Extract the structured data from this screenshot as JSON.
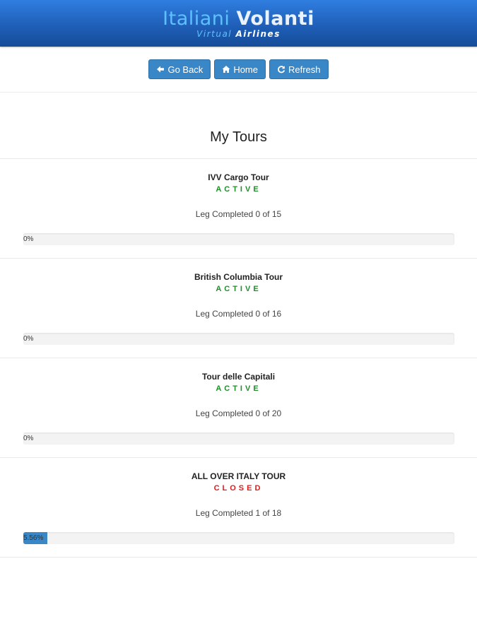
{
  "header": {
    "logo_word_1": "Italiani",
    "logo_word_2": "Volanti",
    "logo_sub_1": "Virtual",
    "logo_sub_2": "Airlines",
    "brand_color": "#1f5fb8"
  },
  "toolbar": {
    "back_label": "Go Back",
    "back_icon": "arrow-left-icon",
    "home_label": "Home",
    "home_icon": "home-icon",
    "refresh_label": "Refresh",
    "refresh_icon": "refresh-icon",
    "button_color": "#3a87c8"
  },
  "page": {
    "title": "My Tours"
  },
  "tours": [
    {
      "name": "IVV Cargo Tour",
      "status": "ACTIVE",
      "legs_text": "Leg Completed 0 of 15",
      "progress_label": "0%",
      "progress_percent": 0
    },
    {
      "name": "British Columbia Tour",
      "status": "ACTIVE",
      "legs_text": "Leg Completed 0 of 16",
      "progress_label": "0%",
      "progress_percent": 0
    },
    {
      "name": "Tour delle Capitali",
      "status": "ACTIVE",
      "legs_text": "Leg Completed 0 of 20",
      "progress_label": "0%",
      "progress_percent": 0
    },
    {
      "name": "ALL OVER ITALY TOUR",
      "status": "CLOSED",
      "legs_text": "Leg Completed 1 of 18",
      "progress_label": "5.56%",
      "progress_percent": 5.56
    }
  ],
  "status_colors": {
    "active": "#1e8f2a",
    "closed": "#e01b1b"
  }
}
